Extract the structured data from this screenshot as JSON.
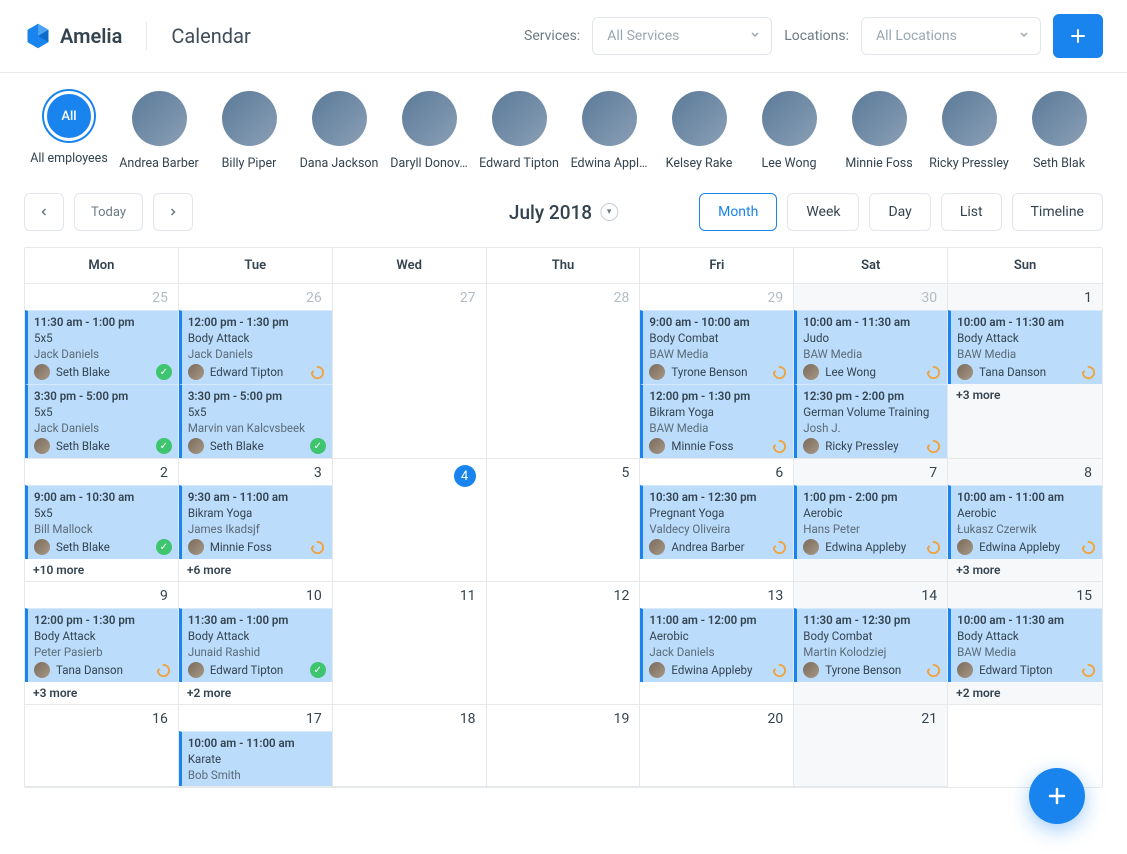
{
  "app": {
    "name": "Amelia",
    "pageTitle": "Calendar"
  },
  "filters": {
    "servicesLabel": "Services:",
    "servicesPlaceholder": "All Services",
    "locationsLabel": "Locations:",
    "locationsPlaceholder": "All Locations"
  },
  "employees": [
    {
      "id": "all",
      "name": "All employees",
      "all": true
    },
    {
      "id": "e1",
      "name": "Andrea Barber"
    },
    {
      "id": "e2",
      "name": "Billy Piper"
    },
    {
      "id": "e3",
      "name": "Dana Jackson"
    },
    {
      "id": "e4",
      "name": "Daryll Donov…"
    },
    {
      "id": "e5",
      "name": "Edward Tipton"
    },
    {
      "id": "e6",
      "name": "Edwina Appl…"
    },
    {
      "id": "e7",
      "name": "Kelsey Rake"
    },
    {
      "id": "e8",
      "name": "Lee Wong"
    },
    {
      "id": "e9",
      "name": "Minnie Foss"
    },
    {
      "id": "e10",
      "name": "Ricky Pressley"
    },
    {
      "id": "e11",
      "name": "Seth Blak"
    }
  ],
  "toolbar": {
    "today": "Today",
    "monthLabel": "July 2018",
    "views": {
      "month": "Month",
      "week": "Week",
      "day": "Day",
      "list": "List",
      "timeline": "Timeline"
    }
  },
  "calendar": {
    "weekdays": [
      "Mon",
      "Tue",
      "Wed",
      "Thu",
      "Fri",
      "Sat",
      "Sun"
    ],
    "cells": [
      {
        "date": 25,
        "dim": true,
        "events": [
          {
            "time": "11:30 am - 1:00 pm",
            "service": "5x5",
            "client": "Jack Daniels",
            "employee": "Seth Blake",
            "status": "approved"
          },
          {
            "time": "3:30 pm - 5:00 pm",
            "service": "5x5",
            "client": "Jack Daniels",
            "employee": "Seth Blake",
            "status": "approved"
          }
        ]
      },
      {
        "date": 26,
        "dim": true,
        "events": [
          {
            "time": "12:00 pm - 1:30 pm",
            "service": "Body Attack",
            "client": "Jack Daniels",
            "employee": "Edward Tipton",
            "status": "pending"
          },
          {
            "time": "3:30 pm - 5:00 pm",
            "service": "5x5",
            "client": "Marvin van Kalcvsbeek",
            "employee": "Seth Blake",
            "status": "approved"
          }
        ]
      },
      {
        "date": 27,
        "dim": true,
        "events": []
      },
      {
        "date": 28,
        "dim": true,
        "events": []
      },
      {
        "date": 29,
        "dim": true,
        "events": [
          {
            "time": "9:00 am - 10:00 am",
            "service": "Body Combat",
            "client": "BAW Media",
            "employee": "Tyrone Benson",
            "status": "pending"
          },
          {
            "time": "12:00 pm - 1:30 pm",
            "service": "Bikram Yoga",
            "client": "BAW Media",
            "employee": "Minnie Foss",
            "status": "pending"
          }
        ]
      },
      {
        "date": 30,
        "dim": true,
        "weekend": true,
        "events": [
          {
            "time": "10:00 am - 11:30 am",
            "service": "Judo",
            "client": "BAW Media",
            "employee": "Lee Wong",
            "status": "pending"
          },
          {
            "time": "12:30 pm - 2:00 pm",
            "service": "German Volume Training",
            "client": "Josh J.",
            "employee": "Ricky Pressley",
            "status": "pending"
          }
        ]
      },
      {
        "date": 1,
        "weekend": true,
        "events": [
          {
            "time": "10:00 am - 11:30 am",
            "service": "Body Attack",
            "client": "BAW Media",
            "employee": "Tana Danson",
            "status": "pending"
          }
        ],
        "more": "+3 more"
      },
      {
        "date": 2,
        "events": [
          {
            "time": "9:00 am - 10:30 am",
            "service": "5x5",
            "client": "Bill Mallock",
            "employee": "Seth Blake",
            "status": "approved"
          }
        ],
        "more": "+10 more"
      },
      {
        "date": 3,
        "events": [
          {
            "time": "9:30 am - 11:00 am",
            "service": "Bikram Yoga",
            "client": "James Ikadsjf",
            "employee": "Minnie Foss",
            "status": "pending"
          }
        ],
        "more": "+6 more"
      },
      {
        "date": 4,
        "today": true,
        "events": []
      },
      {
        "date": 5,
        "events": []
      },
      {
        "date": 6,
        "events": [
          {
            "time": "10:30 am - 12:30 pm",
            "service": "Pregnant Yoga",
            "client": "Valdecy Oliveira",
            "employee": "Andrea Barber",
            "status": "pending"
          }
        ]
      },
      {
        "date": 7,
        "weekend": true,
        "events": [
          {
            "time": "1:00 pm - 2:00 pm",
            "service": "Aerobic",
            "client": "Hans Peter",
            "employee": "Edwina Appleby",
            "status": "pending"
          }
        ]
      },
      {
        "date": 8,
        "weekend": true,
        "events": [
          {
            "time": "10:00 am - 11:00 am",
            "service": "Aerobic",
            "client": "Łukasz Czerwik",
            "employee": "Edwina Appleby",
            "status": "pending"
          }
        ],
        "more": "+3 more"
      },
      {
        "date": 9,
        "events": [
          {
            "time": "12:00 pm - 1:30 pm",
            "service": "Body Attack",
            "client": "Peter Pasierb",
            "employee": "Tana Danson",
            "status": "pending"
          }
        ],
        "more": "+3 more"
      },
      {
        "date": 10,
        "events": [
          {
            "time": "11:30 am - 1:00 pm",
            "service": "Body Attack",
            "client": "Junaid Rashid",
            "employee": "Edward Tipton",
            "status": "approved"
          }
        ],
        "more": "+2 more"
      },
      {
        "date": 11,
        "events": []
      },
      {
        "date": 12,
        "events": []
      },
      {
        "date": 13,
        "events": [
          {
            "time": "11:00 am - 12:00 pm",
            "service": "Aerobic",
            "client": "Jack Daniels",
            "employee": "Edwina Appleby",
            "status": "pending"
          }
        ]
      },
      {
        "date": 14,
        "weekend": true,
        "events": [
          {
            "time": "11:30 am - 12:30 pm",
            "service": "Body Combat",
            "client": "Martin Kolodziej",
            "employee": "Tyrone Benson",
            "status": "pending"
          }
        ]
      },
      {
        "date": 15,
        "weekend": true,
        "events": [
          {
            "time": "10:00 am - 11:30 am",
            "service": "Body Attack",
            "client": "BAW Media",
            "employee": "Edward Tipton",
            "status": "pending"
          }
        ],
        "more": "+2 more"
      },
      {
        "date": 16,
        "events": []
      },
      {
        "date": 17,
        "events": [
          {
            "time": "10:00 am - 11:00 am",
            "service": "Karate",
            "client": "Bob Smith"
          }
        ]
      },
      {
        "date": 18,
        "events": []
      },
      {
        "date": 19,
        "events": []
      },
      {
        "date": 20,
        "events": []
      },
      {
        "date": 21,
        "weekend": true,
        "events": []
      }
    ]
  }
}
